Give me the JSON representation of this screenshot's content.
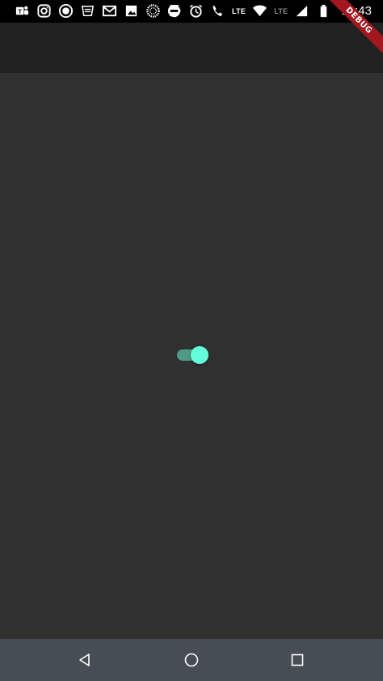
{
  "status_bar": {
    "time": "12:43",
    "lte_label_1": "LTE",
    "lte_label_2": "LTE",
    "left_icons": [
      "teams-icon",
      "instagram-icon",
      "circle-app-icon",
      "grammarly-icon",
      "gmail-icon",
      "image-icon",
      "dotted-circle-icon",
      "check-flag-icon"
    ],
    "right_icons": [
      "do-not-disturb-icon",
      "alarm-icon",
      "wifi-call-icon",
      "wifi-icon",
      "signal-icon",
      "battery-icon"
    ]
  },
  "debug_banner": {
    "label": "DEBUG",
    "color": "#a3171f"
  },
  "colors": {
    "background": "#303030",
    "app_bar": "#212121",
    "nav_bar": "#474d55",
    "switch_track": "#4f9a86",
    "switch_thumb": "#64ffda"
  },
  "switch": {
    "state": "on"
  },
  "nav_bar": {
    "buttons": [
      "back-icon",
      "home-icon",
      "recents-icon"
    ]
  }
}
